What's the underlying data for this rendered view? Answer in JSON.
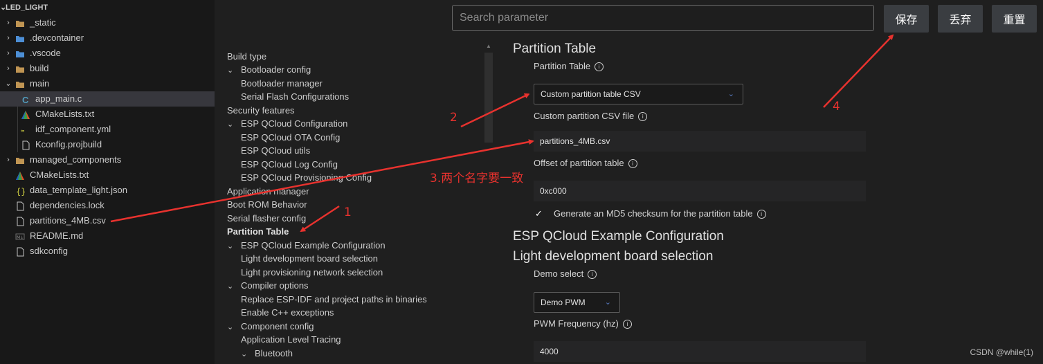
{
  "explorer": {
    "root": "LED_LIGHT",
    "items": [
      {
        "label": "_static",
        "type": "folder",
        "collapsed": true
      },
      {
        "label": ".devcontainer",
        "type": "folder",
        "collapsed": true
      },
      {
        "label": ".vscode",
        "type": "folder",
        "collapsed": true
      },
      {
        "label": "build",
        "type": "folder",
        "collapsed": true
      },
      {
        "label": "main",
        "type": "folder",
        "collapsed": false
      },
      {
        "label": "app_main.c",
        "type": "c-file",
        "selected": true
      },
      {
        "label": "CMakeLists.txt",
        "type": "cmake-file"
      },
      {
        "label": "idf_component.yml",
        "type": "yml-file"
      },
      {
        "label": "Kconfig.projbuild",
        "type": "file"
      },
      {
        "label": "managed_components",
        "type": "folder",
        "collapsed": true
      },
      {
        "label": "CMakeLists.txt",
        "type": "cmake-file"
      },
      {
        "label": "data_template_light.json",
        "type": "json-file"
      },
      {
        "label": "dependencies.lock",
        "type": "file"
      },
      {
        "label": "partitions_4MB.csv",
        "type": "file"
      },
      {
        "label": "README.md",
        "type": "md-file"
      },
      {
        "label": "sdkconfig",
        "type": "file"
      }
    ]
  },
  "nav": {
    "items": [
      {
        "label": "Build type"
      },
      {
        "label": "Bootloader config",
        "caret": "collapse"
      },
      {
        "label": "Bootloader manager"
      },
      {
        "label": "Serial Flash Configurations"
      },
      {
        "label": "Security features"
      },
      {
        "label": "ESP QCloud Configuration",
        "caret": "collapse"
      },
      {
        "label": "ESP QCloud OTA Config"
      },
      {
        "label": "ESP QCloud utils"
      },
      {
        "label": "ESP QCloud Log Config"
      },
      {
        "label": "ESP QCloud Provisioning Config"
      },
      {
        "label": "Application manager"
      },
      {
        "label": "Boot ROM Behavior"
      },
      {
        "label": "Serial flasher config"
      },
      {
        "label": "Partition Table",
        "bold": true
      },
      {
        "label": "ESP QCloud Example Configuration",
        "caret": "collapse"
      },
      {
        "label": "Light development board selection"
      },
      {
        "label": "Light provisioning network selection"
      },
      {
        "label": "Compiler options",
        "caret": "collapse"
      },
      {
        "label": "Replace ESP-IDF and project paths in binaries"
      },
      {
        "label": "Enable C++ exceptions"
      },
      {
        "label": "Component config",
        "caret": "collapse"
      },
      {
        "label": "Application Level Tracing"
      },
      {
        "label": "Bluetooth",
        "caret": "collapse"
      }
    ]
  },
  "topbar": {
    "search_placeholder": "Search parameter",
    "save_label": "保存",
    "discard_label": "丢弃",
    "reset_label": "重置"
  },
  "form": {
    "section_partition": "Partition Table",
    "partition_table_label": "Partition Table",
    "partition_table_value": "Custom partition table CSV",
    "custom_csv_label": "Custom partition CSV file",
    "custom_csv_value": "partitions_4MB.csv",
    "offset_label": "Offset of partition table",
    "offset_value": "0xc000",
    "md5_label": "Generate an MD5 checksum for the partition table",
    "md5_checked": true,
    "section_example": "ESP QCloud Example Configuration",
    "section_board": "Light development board selection",
    "demo_select_label": "Demo select",
    "demo_select_value": "Demo PWM",
    "pwm_freq_label": "PWM Frequency (hz)",
    "pwm_freq_value": "4000"
  },
  "annotations": {
    "n1": "1",
    "n2": "2",
    "n3": "3.两个名字要一致",
    "n4": "4",
    "color": "#e8322e"
  },
  "watermark": "CSDN @while(1)"
}
